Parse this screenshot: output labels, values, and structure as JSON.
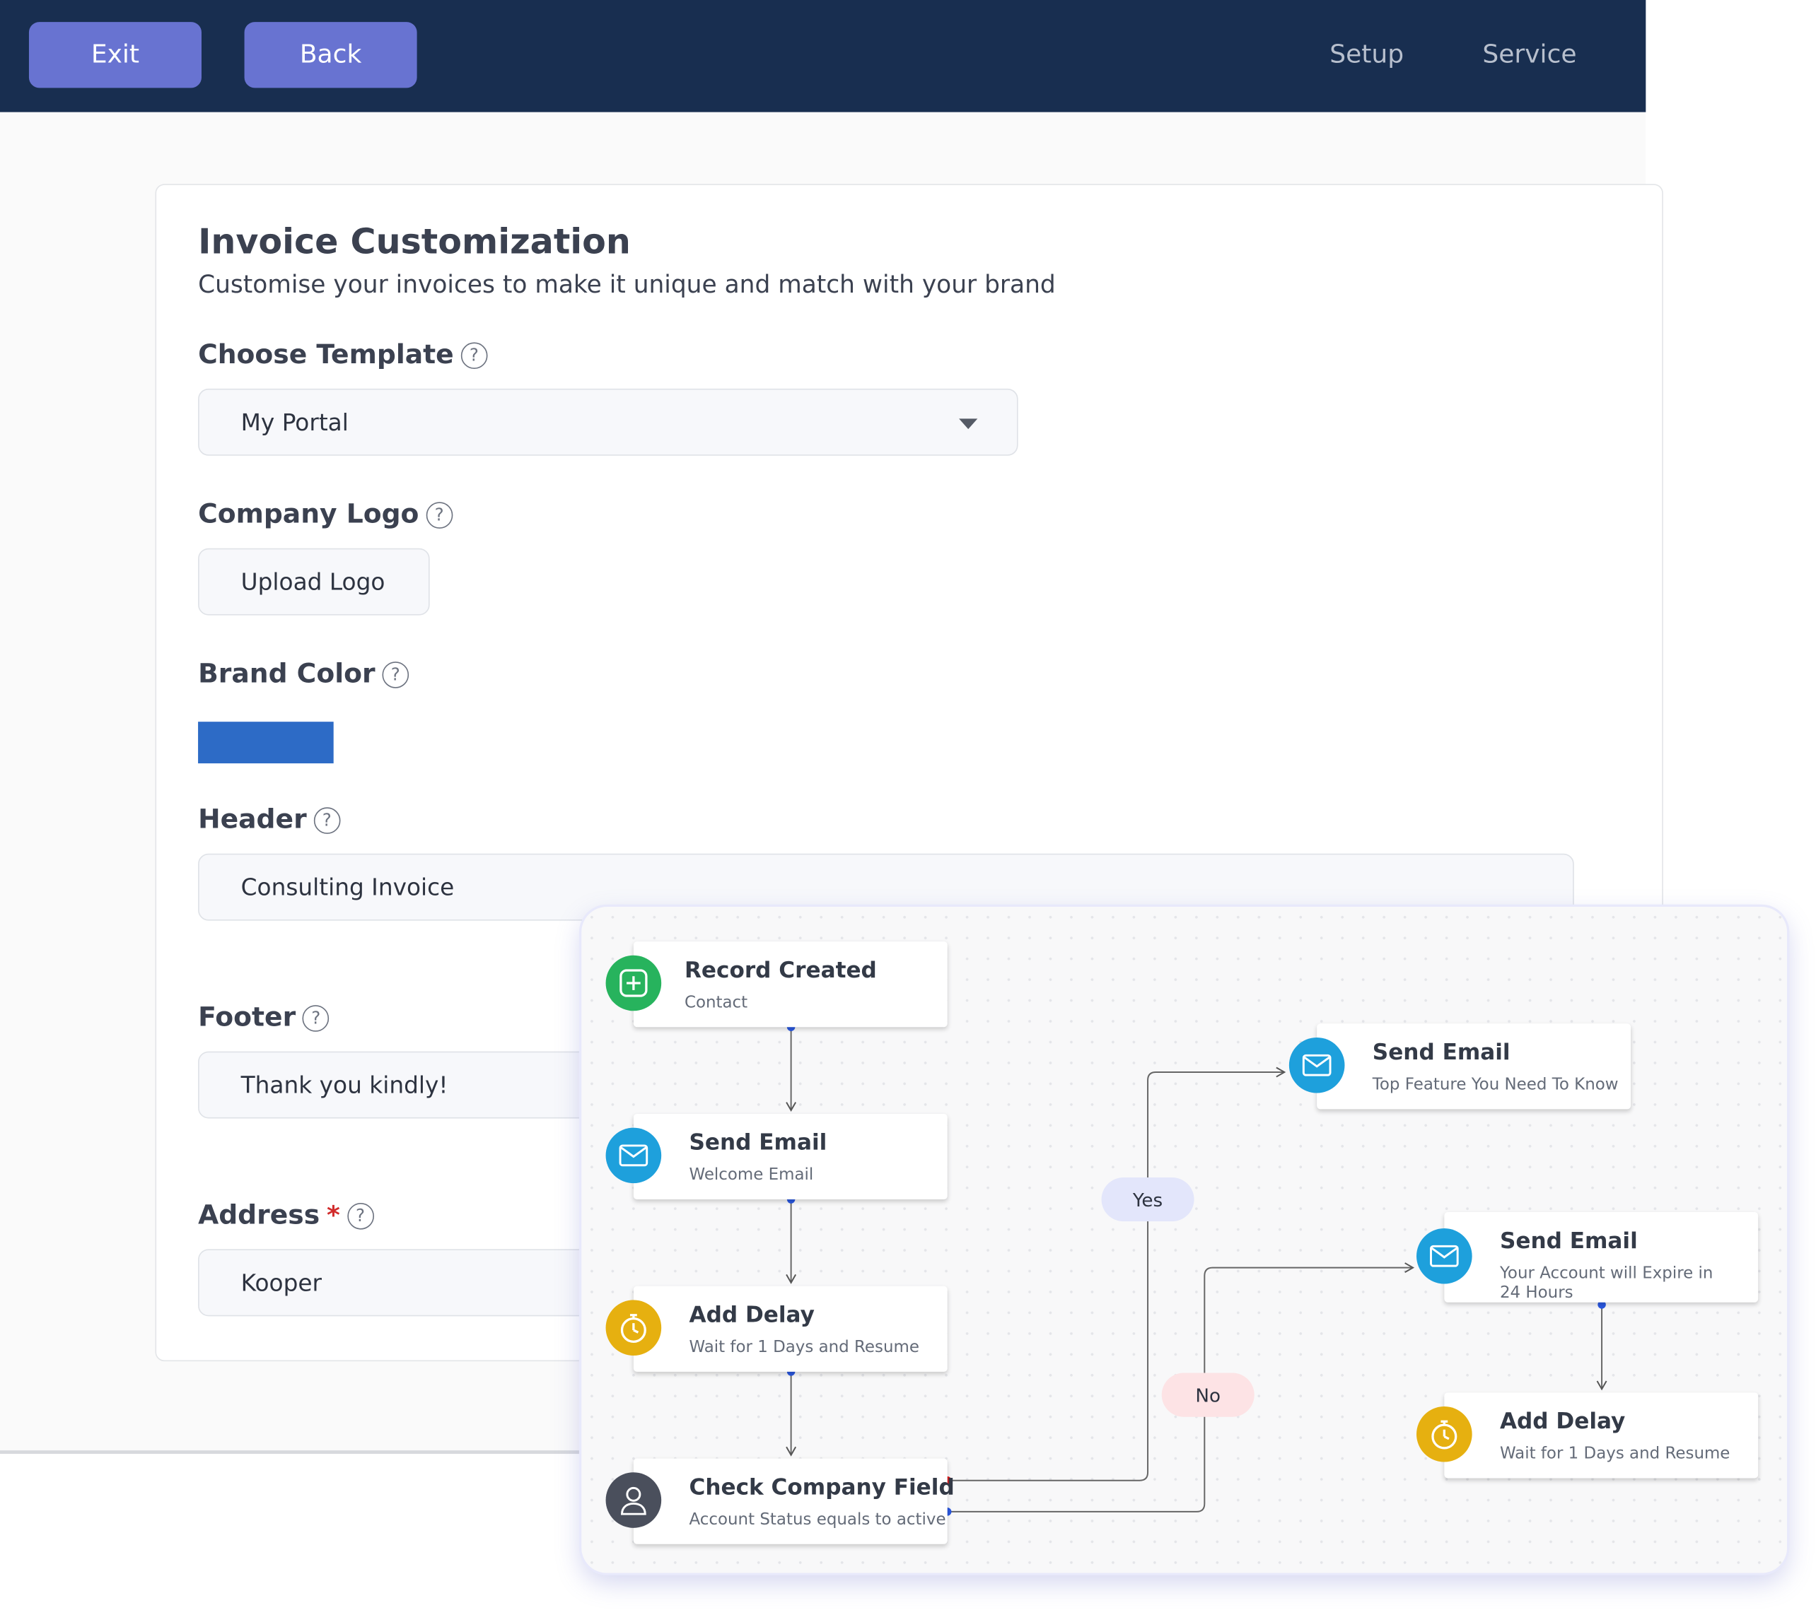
{
  "topbar": {
    "exit_label": "Exit",
    "back_label": "Back",
    "nav": [
      "Setup",
      "Service"
    ]
  },
  "form": {
    "title": "Invoice Customization",
    "subtitle": "Customise your invoices to make it unique and match with your brand",
    "template": {
      "label": "Choose Template",
      "value": "My Portal"
    },
    "logo": {
      "label": "Company Logo",
      "button_label": "Upload Logo"
    },
    "brand_color": {
      "label": "Brand Color",
      "value": "#2d6bc6"
    },
    "header": {
      "label": "Header",
      "value": "Consulting Invoice"
    },
    "footer": {
      "label": "Footer",
      "value": "Thank you kindly!"
    },
    "address": {
      "label": "Address",
      "required_mark": "*",
      "value": "Kooper"
    },
    "help_glyph": "?"
  },
  "workflow": {
    "nodes": [
      {
        "title": "Record Created",
        "subtitle": "Contact",
        "icon": "plus-square-icon",
        "color": "#27b35d"
      },
      {
        "title": "Send Email",
        "subtitle": "Welcome Email",
        "icon": "envelope-icon",
        "color": "#1ea0dc"
      },
      {
        "title": "Add Delay",
        "subtitle": "Wait for 1 Days and Resume",
        "icon": "stopwatch-icon",
        "color": "#e6b010"
      },
      {
        "title": "Check Company Field",
        "subtitle": "Account Status equals to active",
        "icon": "person-icon",
        "color": "#4a4f5c"
      },
      {
        "title": "Send Email",
        "subtitle": "Top Feature You Need To Know",
        "icon": "envelope-icon",
        "color": "#1ea0dc"
      },
      {
        "title": "Send Email",
        "subtitle": "Your Account will Expire in 24 Hours",
        "icon": "envelope-icon",
        "color": "#1ea0dc"
      },
      {
        "title": "Add Delay",
        "subtitle": "Wait for 1 Days and Resume",
        "icon": "stopwatch-icon",
        "color": "#e6b010"
      }
    ],
    "branches": {
      "yes_label": "Yes",
      "no_label": "No"
    }
  }
}
